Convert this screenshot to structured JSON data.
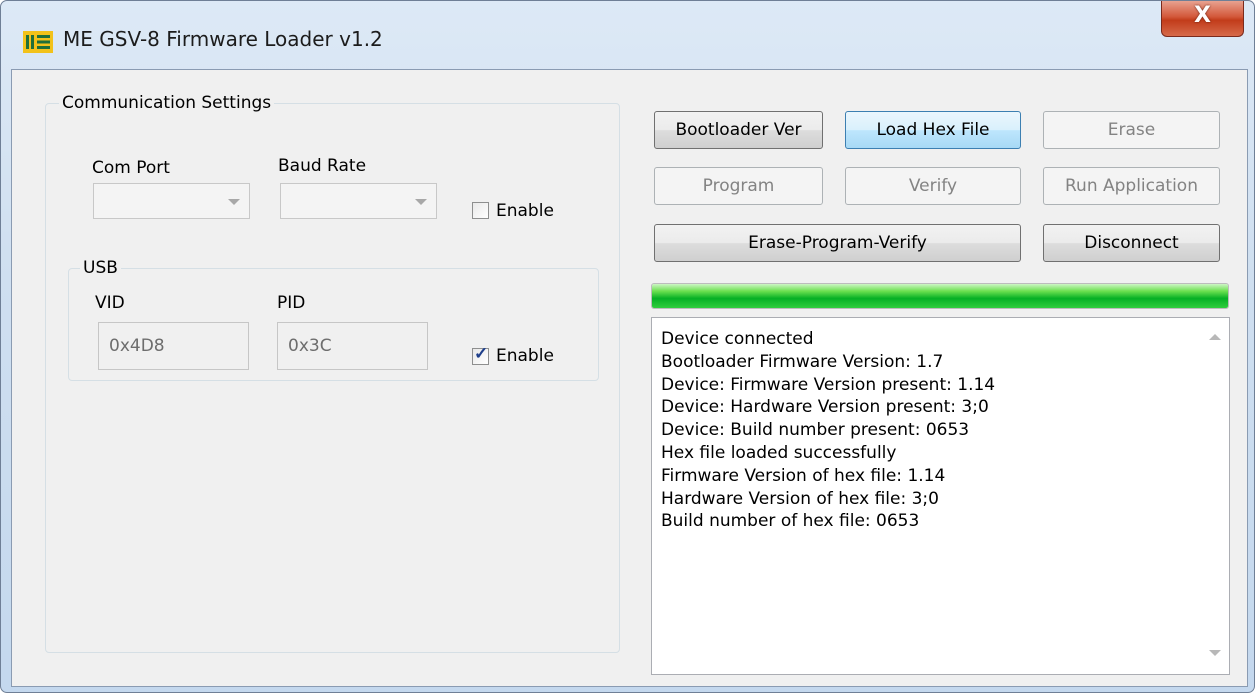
{
  "window": {
    "title": "ME GSV-8 Firmware Loader v1.2",
    "icon_name": "me-logo-icon",
    "close_label": "X"
  },
  "comm": {
    "group_label": "Communication Settings",
    "com_port_label": "Com Port",
    "baud_rate_label": "Baud Rate",
    "com_port_value": "",
    "baud_rate_value": "",
    "enable_label": "Enable",
    "enable_checked": false
  },
  "usb": {
    "group_label": "USB",
    "vid_label": "VID",
    "pid_label": "PID",
    "vid_value": "0x4D8",
    "pid_value": "0x3C",
    "enable_label": "Enable",
    "enable_checked": true
  },
  "buttons": {
    "bootloader_ver": "Bootloader Ver",
    "load_hex_file": "Load Hex File",
    "erase": "Erase",
    "program": "Program",
    "verify": "Verify",
    "run_application": "Run Application",
    "erase_program_verify": "Erase-Program-Verify",
    "disconnect": "Disconnect"
  },
  "progress": {
    "fraction": 1.0
  },
  "log": {
    "lines": [
      "Device connected",
      "Bootloader Firmware Version: 1.7",
      "Device: Firmware Version present: 1.14",
      "Device: Hardware Version present: 3;0",
      "Device: Build number present: 0653",
      "Hex file loaded successfully",
      "Firmware Version of hex file: 1.14",
      "Hardware Version of hex file: 3;0",
      "Build number of hex file: 0653"
    ]
  },
  "colors": {
    "progress_green": "#06b025",
    "focus_blue": "#3c7fb1",
    "close_red": "#c23c1a"
  }
}
